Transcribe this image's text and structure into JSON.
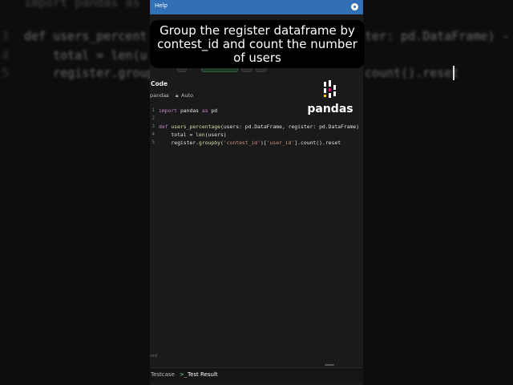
{
  "background": {
    "lines": [
      {
        "ln": "",
        "text": "import pandas as"
      },
      {
        "ln": "3",
        "text": "def users_percent"
      },
      {
        "ln": "4",
        "text": "    total = len(u"
      },
      {
        "ln": "5",
        "text": "    register.group"
      }
    ],
    "right_lines": [
      "ter: pd.DataFrame) -",
      "count().reset"
    ]
  },
  "help_bar": {
    "title": "Help"
  },
  "caption": {
    "text": "Group the register dataframe by contest_id and count the number of users"
  },
  "editor_header": {
    "title": "Code"
  },
  "language_row": {
    "language": "pandas",
    "mode": "Auto"
  },
  "code_lines": [
    {
      "ln": "1",
      "parts": [
        {
          "t": "import",
          "c": "kw"
        },
        {
          "t": " pandas ",
          "c": ""
        },
        {
          "t": "as",
          "c": "kw"
        },
        {
          "t": " pd",
          "c": ""
        }
      ]
    },
    {
      "ln": "2",
      "parts": []
    },
    {
      "ln": "3",
      "parts": [
        {
          "t": "def",
          "c": "kw"
        },
        {
          "t": " ",
          "c": ""
        },
        {
          "t": "users_percentage",
          "c": "fn"
        },
        {
          "t": "(users: pd.DataFrame, register: pd.DataFrame) -",
          "c": ""
        }
      ]
    },
    {
      "ln": "4",
      "parts": [
        {
          "t": "    total = ",
          "c": ""
        },
        {
          "t": "len",
          "c": "fn"
        },
        {
          "t": "(users)",
          "c": ""
        }
      ]
    },
    {
      "ln": "5",
      "parts": [
        {
          "t": "    register.",
          "c": ""
        },
        {
          "t": "groupby",
          "c": "fn"
        },
        {
          "t": "(",
          "c": ""
        },
        {
          "t": "'contest_id'",
          "c": "str"
        },
        {
          "t": ")[",
          "c": ""
        },
        {
          "t": "'user_id'",
          "c": "str"
        },
        {
          "t": "].count().reset",
          "c": ""
        }
      ]
    }
  ],
  "logo": {
    "word": "pandas"
  },
  "footer": {
    "label": "red"
  },
  "bottom_tabs": {
    "testcase": "Testcase",
    "test_result": "Test Result",
    "arrow": ">_"
  },
  "icons": {
    "gear": "gear-icon",
    "lock": "lock-icon",
    "chevron": "chevron-down-icon",
    "check": "check-icon",
    "terminal": "terminal-icon"
  },
  "colors": {
    "help_bar": "#3170b4",
    "keyword": "#c586c0",
    "function": "#dcdcaa",
    "string": "#ce9178",
    "pandas_pink": "#e70488",
    "pandas_yellow": "#ffca00"
  }
}
